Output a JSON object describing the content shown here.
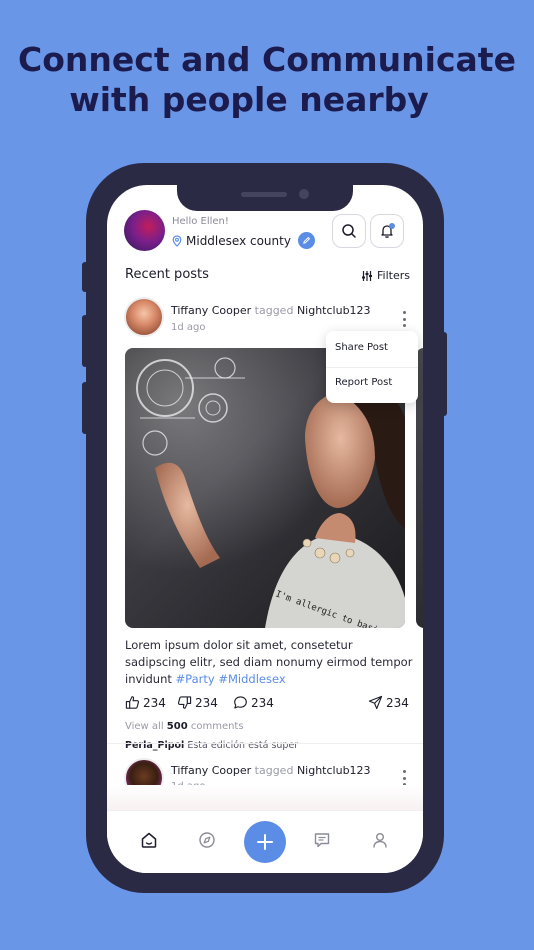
{
  "headline": {
    "line1": "Connect and Communicate",
    "line2": "with people nearby"
  },
  "colors": {
    "background": "#6a96e8",
    "accent": "#5b8de6",
    "phone_frame": "#2b2a45",
    "headline": "#1c1b4d"
  },
  "header": {
    "greeting": "Hello Ellen!",
    "location": "Middlesex county",
    "icons": [
      "location-pin-icon",
      "edit-icon",
      "search-icon",
      "bell-icon"
    ]
  },
  "feed": {
    "title": "Recent posts",
    "filters_label": "Filters"
  },
  "post": {
    "author": "Tiffany Cooper",
    "tagged_word": "tagged",
    "tagged_place": "Nightclub123",
    "time": "1d ago",
    "menu": {
      "share": "Share Post",
      "report": "Report Post"
    },
    "caption": "Lorem ipsum dolor sit amet, consetetur sadipscing elitr, sed diam nonumy eirmod tempor invidunt",
    "hashtag1": "#Party",
    "hashtag2": "#Middlesex",
    "likes": "234",
    "dislikes": "234",
    "comments": "234",
    "shares": "234",
    "view_all_prefix": "View all",
    "view_all_count": "500",
    "view_all_suffix": "comments",
    "latest_comment_user": "Perla_Pipol",
    "latest_comment_text": "Esta edición está super",
    "shirt_text": "I'm allergic to basic"
  },
  "post2": {
    "author": "Tiffany Cooper",
    "tagged_word": "tagged",
    "tagged_place": "Nightclub123",
    "time": "1d ago"
  },
  "nav": {
    "items": [
      "home-icon",
      "explore-icon",
      "add-icon",
      "chat-icon",
      "profile-icon"
    ]
  }
}
